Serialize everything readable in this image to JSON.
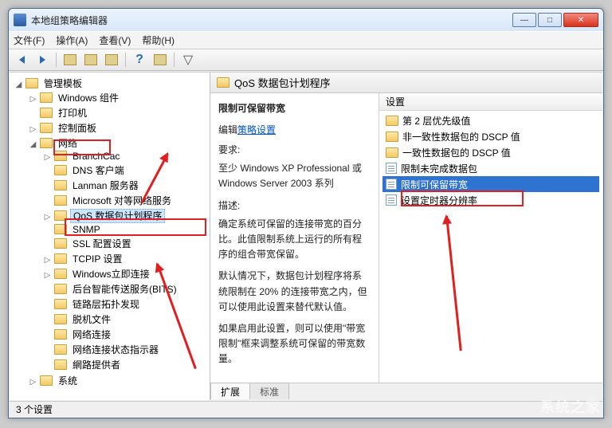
{
  "window": {
    "title": "本地组策略编辑器"
  },
  "menu": {
    "file": "文件(F)",
    "action": "操作(A)",
    "view": "查看(V)",
    "help": "帮助(H)"
  },
  "tree": {
    "root": "管理模板",
    "n_windows_components": "Windows 组件",
    "n_printer": "打印机",
    "n_control_panel": "控制面板",
    "n_network": "网络",
    "n_branchcache": "BranchCac",
    "n_dns": "DNS 客户端",
    "n_lanman": "Lanman 服务器",
    "n_msp2p": "Microsoft 对等网络服务",
    "n_qos": "QoS 数据包计划程序",
    "n_snmp": "SNMP",
    "n_ssl": "SSL 配置设置",
    "n_tcpip": "TCPIP 设置",
    "n_winconn": "Windows立即连接",
    "n_bits": "后台智能传送服务(BITS)",
    "n_lltd": "链路层拓扑发现",
    "n_offline": "脱机文件",
    "n_netconn": "网络连接",
    "n_netstatus": "网络连接状态指示器",
    "n_netlogon": "網路提供者",
    "n_system": "系统"
  },
  "right": {
    "header": "QoS 数据包计划程序",
    "desc_title": "限制可保留带宽",
    "edit_label": "编辑",
    "policy_link": "策略设置",
    "req_label": "要求:",
    "req_text": "至少 Windows XP Professional 或 Windows Server 2003 系列",
    "desc_label": "描述:",
    "desc_p1": "确定系统可保留的连接带宽的百分比。此值限制系统上运行的所有程序的组合带宽保留。",
    "desc_p2": "默认情况下，数据包计划程序将系统限制在 20% 的连接带宽之内，但可以使用此设置来替代默认值。",
    "desc_p3": "如果启用此设置，则可以使用\"带宽限制\"框来调整系统可保留的带宽数量。",
    "settings_header": "设置",
    "s1": "第 2 层优先级值",
    "s2": "非一致性数据包的 DSCP 值",
    "s3": "一致性数据包的 DSCP 值",
    "s4": "限制未完成数据包",
    "s5": "限制可保留带宽",
    "s6": "设置定时器分辨率",
    "tab_ext": "扩展",
    "tab_std": "标准"
  },
  "status": {
    "text": "3 个设置"
  },
  "watermark": "系统之家"
}
